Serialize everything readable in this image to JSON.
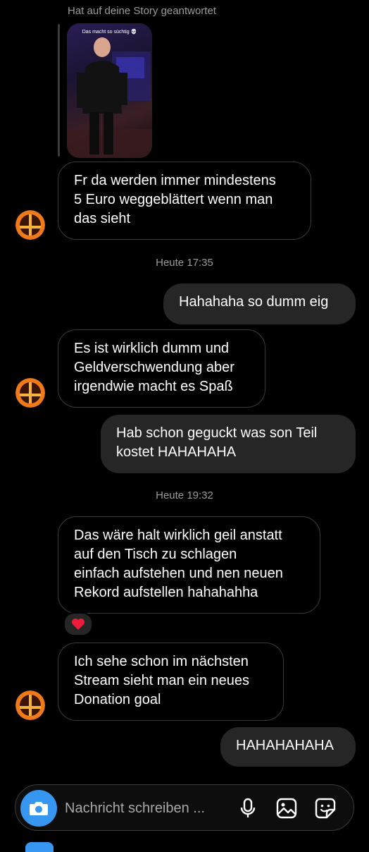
{
  "story_reply": {
    "caption": "Hat auf deine Story geantwortet",
    "thumbnail_text": "Das macht so süchtig 💀"
  },
  "messages": [
    {
      "type": "in",
      "text": "Fr da werden immer mindestens\n5 Euro weggeblättert wenn man\ndas sieht"
    },
    {
      "type": "time",
      "text": "Heute 17:35"
    },
    {
      "type": "out",
      "text": "Hahahaha so dumm eig"
    },
    {
      "type": "in",
      "text": "Es ist wirklich dumm und\nGeldverschwendung aber\nirgendwie macht es Spaß"
    },
    {
      "type": "out",
      "text": "Hab schon geguckt was son Teil\nkostet HAHAHAHA"
    },
    {
      "type": "time",
      "text": "Heute 19:32"
    },
    {
      "type": "in",
      "text": "Das wäre halt wirklich geil anstatt\nauf den Tisch zu schlagen\neinfach aufstehen und nen neuen\nRekord aufstellen hahahahha"
    },
    {
      "type": "in",
      "text": "Ich sehe schon im nächsten\nStream sieht man ein neues\nDonation goal"
    },
    {
      "type": "out",
      "text": "HAHAHAHAHA"
    }
  ],
  "reaction": {
    "emoji": "❤️",
    "icon": "heart-icon"
  },
  "composer": {
    "placeholder": "Nachricht schreiben ...",
    "value": ""
  },
  "icons": {
    "camera": "camera-icon",
    "microphone": "microphone-icon",
    "gallery": "gallery-icon",
    "sticker": "sticker-icon",
    "avatar": "smash-ball-avatar"
  },
  "colors": {
    "background": "#000000",
    "incoming_border": "#3a3a3a",
    "outgoing_bubble": "#262626",
    "accent": "#3797f0",
    "heart": "#ed1c3b",
    "avatar_fire": "#f07a1a"
  }
}
